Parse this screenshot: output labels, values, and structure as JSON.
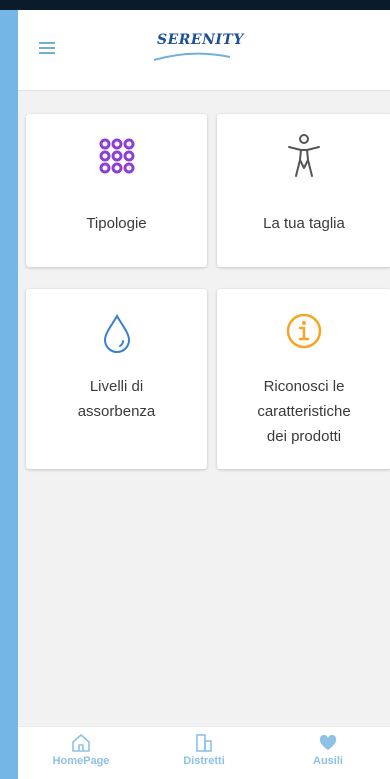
{
  "app": {
    "brand": "SERENITY"
  },
  "colors": {
    "accent_blue": "#73afd9",
    "purple": "#8e3fd6",
    "orange": "#f5a623",
    "blue_icon": "#3a7fd1",
    "gray_icon": "#555555",
    "nav_text": "#8ec1e6"
  },
  "header": {
    "menu_icon": "hamburger-icon",
    "logo_text": "SERENITY"
  },
  "cards": [
    {
      "label": "Tipologie",
      "icon": "grid-dots-icon"
    },
    {
      "label": "La tua taglia",
      "icon": "accessibility-person-icon"
    },
    {
      "label": "Livelli di\nassorbenza",
      "icon": "water-drop-icon"
    },
    {
      "label": "Riconosci le\ncaratteristiche\ndei prodotti",
      "icon": "info-circle-icon"
    }
  ],
  "bottom_nav": [
    {
      "label": "HomePage",
      "icon": "home-icon"
    },
    {
      "label": "Distretti",
      "icon": "buildings-icon"
    },
    {
      "label": "Ausili",
      "icon": "heart-icon"
    }
  ]
}
